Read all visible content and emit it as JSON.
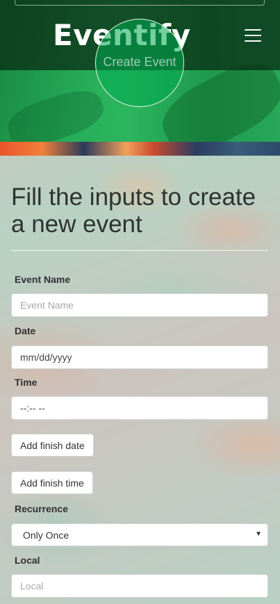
{
  "header": {
    "brand": "Eventify",
    "create_event_label": "Create Event"
  },
  "form": {
    "title": "Fill the inputs to create a new event",
    "event_name": {
      "label": "Event Name",
      "placeholder": "Event Name"
    },
    "date": {
      "label": "Date",
      "placeholder": "mm/dd/yyyy"
    },
    "time": {
      "label": "Time",
      "placeholder": "--:-- --"
    },
    "add_finish_date_label": "Add finish date",
    "add_finish_time_label": "Add finish time",
    "recurrence": {
      "label": "Recurrence",
      "selected": "Only Once"
    },
    "local": {
      "label": "Local",
      "placeholder": "Local"
    }
  },
  "colors": {
    "header_green": "#2cb55f",
    "topbar_dark": "#08281a",
    "accent_circle": "#00aa50"
  },
  "icons": {
    "menu": "hamburger-icon",
    "select_caret": "caret-down-icon"
  }
}
